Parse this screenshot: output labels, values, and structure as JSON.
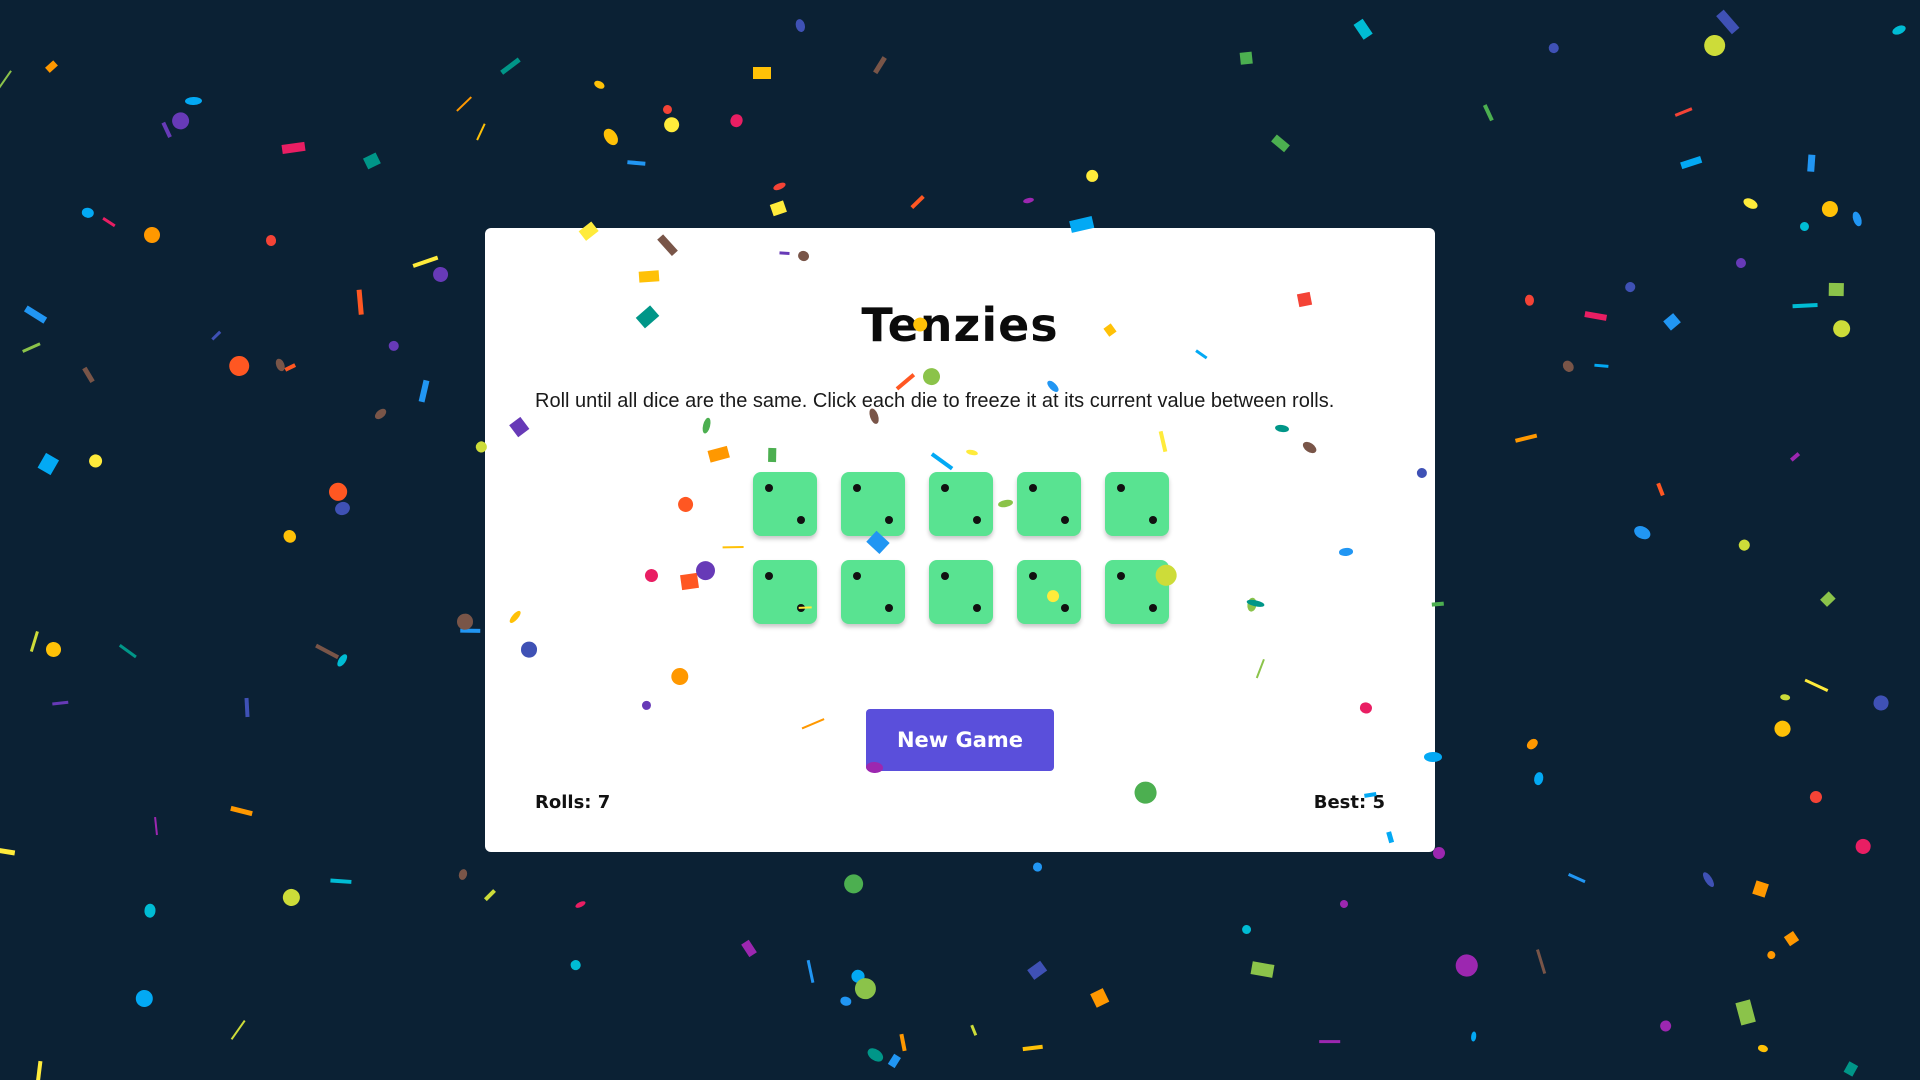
{
  "game": {
    "title": "Tenzies",
    "instructions": "Roll until all dice are the same. Click each die to freeze it at its current value between rolls.",
    "new_game_label": "New Game",
    "rolls_label": "Rolls: 7",
    "best_label": "Best: 5",
    "dice": [
      2,
      2,
      2,
      2,
      2,
      2,
      2,
      2,
      2,
      2
    ],
    "held": [
      true,
      true,
      true,
      true,
      true,
      true,
      true,
      true,
      true,
      true
    ],
    "held_color": "#59e391",
    "button_color": "#5a4fdb",
    "background_color": "#0b2134",
    "status": "won"
  },
  "confetti": {
    "colors": [
      "#f44336",
      "#e91e63",
      "#9c27b0",
      "#673ab7",
      "#3f51b5",
      "#2196f3",
      "#03a9f4",
      "#00bcd4",
      "#009688",
      "#4caf50",
      "#8bc34a",
      "#cddc39",
      "#ffeb3b",
      "#ffc107",
      "#ff9800",
      "#ff5722",
      "#795548"
    ]
  }
}
